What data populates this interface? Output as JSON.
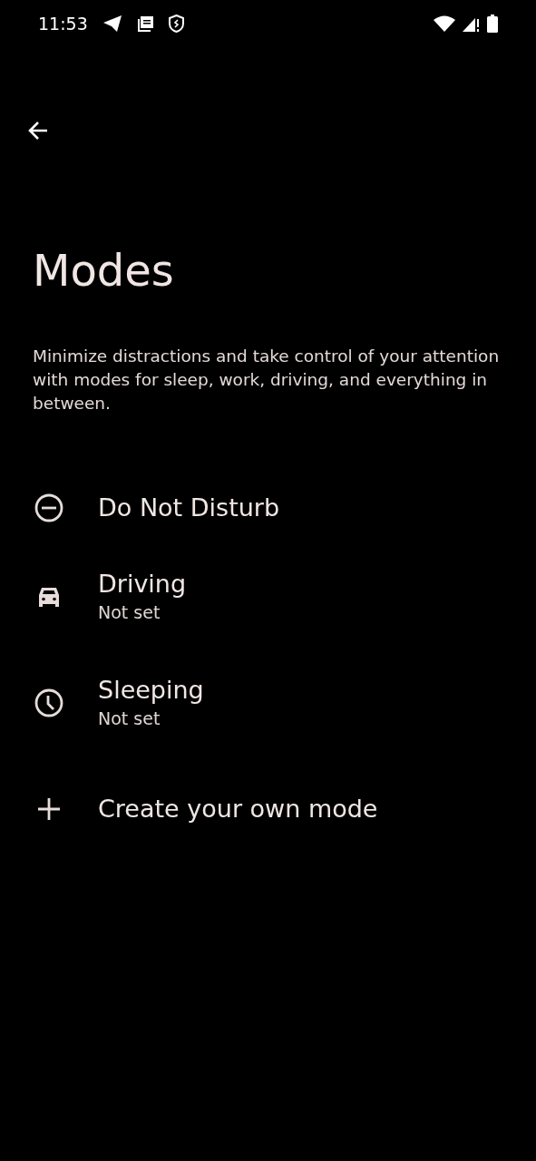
{
  "status_bar": {
    "time": "11:53"
  },
  "title": "Modes",
  "description": "Minimize distractions and take control of your attention with modes for sleep, work, driving, and everything in between.",
  "modes": [
    {
      "kind": "dnd",
      "label": "Do Not Disturb"
    },
    {
      "kind": "car",
      "label": "Driving",
      "subtitle": "Not set"
    },
    {
      "kind": "clock",
      "label": "Sleeping",
      "subtitle": "Not set"
    },
    {
      "kind": "plus",
      "label": "Create your own mode"
    }
  ]
}
